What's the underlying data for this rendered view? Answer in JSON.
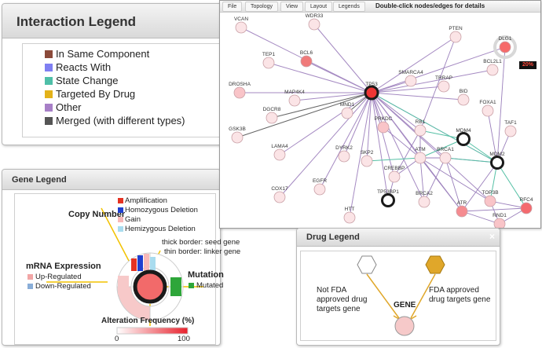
{
  "interaction_legend": {
    "title": "Interaction Legend",
    "items": [
      {
        "label": "In Same Component",
        "color": "#8b4a3a"
      },
      {
        "label": "Reacts With",
        "color": "#7f7ff2"
      },
      {
        "label": "State Change",
        "color": "#4fbfa8"
      },
      {
        "label": "Targeted By Drug",
        "color": "#e3b21a"
      },
      {
        "label": "Other",
        "color": "#a77fc7"
      },
      {
        "label": "Merged (with different types)",
        "color": "#555555"
      }
    ]
  },
  "gene_legend": {
    "title": "Gene Legend",
    "copy_number": {
      "heading": "Copy Number",
      "items": [
        {
          "label": "Amplification",
          "color": "#e53222"
        },
        {
          "label": "Homozygous Deletion",
          "color": "#1f3fcf"
        },
        {
          "label": "Gain",
          "color": "#f7b9b9"
        },
        {
          "label": "Hemizygous Deletion",
          "color": "#a9dcef"
        }
      ]
    },
    "border_notes": [
      "thick border: seed gene",
      "thin border: linker gene"
    ],
    "mrna": {
      "heading": "mRNA Expression",
      "items": [
        {
          "label": "Up-Regulated",
          "color": "#f2a6a6"
        },
        {
          "label": "Down-Regulated",
          "color": "#8aaed8"
        }
      ]
    },
    "mutation": {
      "heading": "Mutation",
      "items": [
        {
          "label": "Mutated",
          "color": "#2ea63a"
        }
      ]
    },
    "alteration": {
      "heading": "Alteration Frequency (%)",
      "min_label": "0",
      "max_label": "100"
    }
  },
  "network": {
    "menu": [
      "File",
      "Topology",
      "View",
      "Layout",
      "Legends"
    ],
    "hint": "Double-click nodes/edges for details",
    "selected_percent": "20%",
    "nodes": [
      {
        "id": "VCAN",
        "label": "VCAN"
      },
      {
        "id": "WDR33",
        "label": "WDR33"
      },
      {
        "id": "PTEN",
        "label": "PTEN"
      },
      {
        "id": "DLG1",
        "label": "DLG1"
      },
      {
        "id": "TEP1",
        "label": "TEP1"
      },
      {
        "id": "BCL6",
        "label": "BCL6"
      },
      {
        "id": "BCL2L1",
        "label": "BCL2L1"
      },
      {
        "id": "DROSHA",
        "label": "DROSHA"
      },
      {
        "id": "TP53",
        "label": "TP53"
      },
      {
        "id": "SMARCA4",
        "label": "SMARCA4"
      },
      {
        "id": "TRRAP",
        "label": "TRRAP"
      },
      {
        "id": "MAP4K4",
        "label": "MAP4K4"
      },
      {
        "id": "BID",
        "label": "BID"
      },
      {
        "id": "MND1",
        "label": "MND1"
      },
      {
        "id": "DGCR8",
        "label": "DGCR8"
      },
      {
        "id": "FOXA1",
        "label": "FOXA1"
      },
      {
        "id": "PRKDC",
        "label": "PRKDC"
      },
      {
        "id": "RB1",
        "label": "RB1"
      },
      {
        "id": "GSK3B",
        "label": "GSK3B"
      },
      {
        "id": "MDM4",
        "label": "MDM4"
      },
      {
        "id": "TAF1",
        "label": "TAF1"
      },
      {
        "id": "DYRK2",
        "label": "DYRK2"
      },
      {
        "id": "LAMA4",
        "label": "LAMA4"
      },
      {
        "id": "SKP2",
        "label": "SKP2"
      },
      {
        "id": "ATM",
        "label": "ATM"
      },
      {
        "id": "BRCA1",
        "label": "BRCA1"
      },
      {
        "id": "MDM2",
        "label": "MDM2"
      },
      {
        "id": "EGFR",
        "label": "EGFR"
      },
      {
        "id": "CREBBP",
        "label": "CREBBP"
      },
      {
        "id": "TP53BP1",
        "label": "TP53BP1"
      },
      {
        "id": "COX17",
        "label": "COX17"
      },
      {
        "id": "BRCA2",
        "label": "BRCA2"
      },
      {
        "id": "ATR",
        "label": "ATR"
      },
      {
        "id": "TOP3B",
        "label": "TOP3B"
      },
      {
        "id": "RFC4",
        "label": "RFC4"
      },
      {
        "id": "HTT",
        "label": "HTT"
      },
      {
        "id": "RND1",
        "label": "RND1"
      }
    ]
  },
  "drug_legend": {
    "title": "Drug Legend",
    "close": "×",
    "not_fda": "Not FDA approved drug targets gene",
    "fda": "FDA approved drug targets gene",
    "gene": "GENE",
    "not_fda_color": "#ffffff",
    "fda_color": "#e0a72a"
  }
}
